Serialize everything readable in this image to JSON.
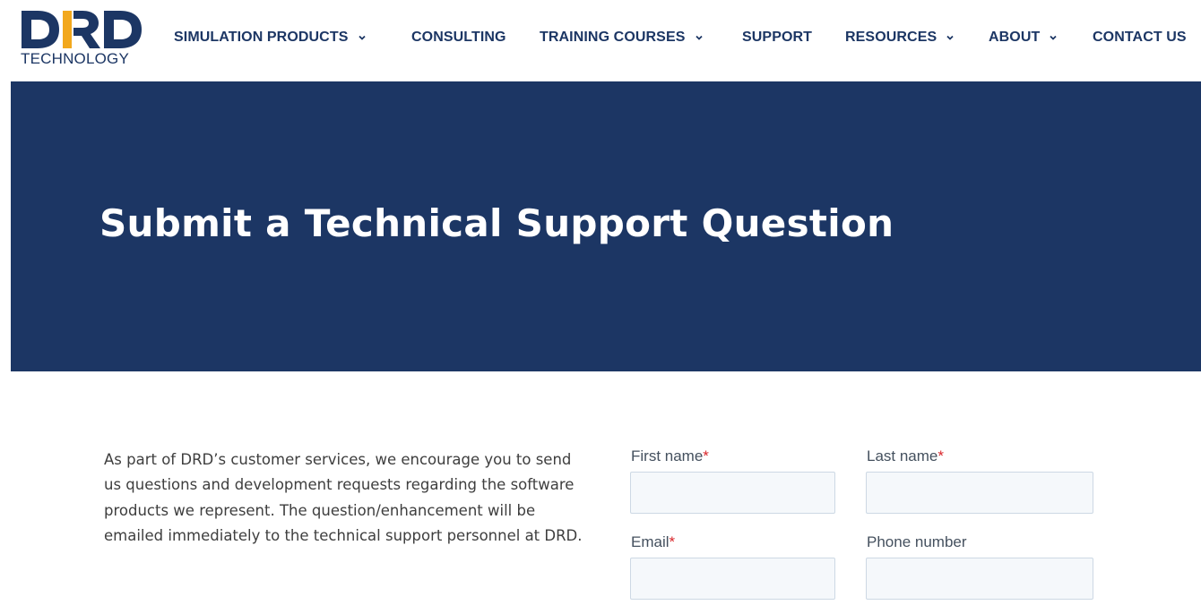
{
  "logo": {
    "letters": [
      "D",
      "R",
      "D"
    ],
    "subtitle": "TECHNOLOGY",
    "colors": {
      "navy": "#1c3664",
      "accent": "#f2a81d"
    }
  },
  "nav": {
    "items": [
      {
        "label": "SIMULATION PRODUCTS",
        "has_dropdown": true,
        "icon": "chevron-down-icon"
      },
      {
        "label": "CONSULTING",
        "has_dropdown": false
      },
      {
        "label": "TRAINING COURSES",
        "has_dropdown": true,
        "icon": "chevron-down-icon"
      },
      {
        "label": "SUPPORT",
        "has_dropdown": false
      },
      {
        "label": "RESOURCES",
        "has_dropdown": true,
        "icon": "chevron-down-icon"
      },
      {
        "label": "ABOUT",
        "has_dropdown": true,
        "icon": "chevron-down-icon"
      },
      {
        "label": "CONTACT US",
        "has_dropdown": false
      }
    ]
  },
  "hero": {
    "title": "Submit a Technical Support Question",
    "background": "#1c3664"
  },
  "intro": {
    "text": "As part of DRD’s customer services, we encourage you to send us questions and development requests regarding the software products we represent. The question/enhancement will be emailed immediately to the technical support personnel at DRD."
  },
  "form": {
    "fields": [
      {
        "label": "First name",
        "required": true,
        "value": ""
      },
      {
        "label": "Last name",
        "required": true,
        "value": ""
      },
      {
        "label": "Email",
        "required": true,
        "value": ""
      },
      {
        "label": "Phone number",
        "required": false,
        "value": ""
      }
    ],
    "required_marker": "*",
    "required_color": "#d9262b"
  }
}
